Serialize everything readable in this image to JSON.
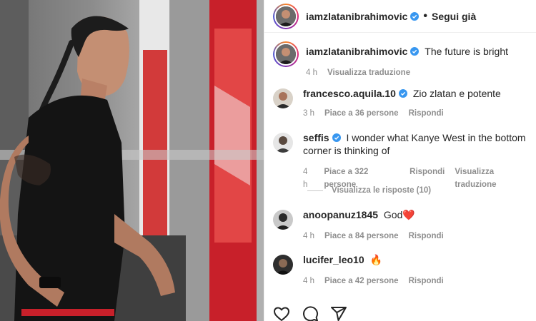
{
  "header": {
    "username": "iamzlatanibrahimovic",
    "separator": "•",
    "follow_label": "Segui già"
  },
  "caption": {
    "username": "iamzlatanibrahimovic",
    "text": "The future is bright",
    "time": "4 h",
    "translate": "Visualizza traduzione"
  },
  "comments": [
    {
      "username": "francesco.aquila.10",
      "verified": true,
      "text": "Zio zlatan e potente",
      "time": "3 h",
      "likes": "Piace a 36 persone",
      "reply": "Rispondi"
    },
    {
      "username": "seffis",
      "verified": true,
      "text": "I wonder what Kanye West in the bottom corner is thinking of",
      "time": "4 h",
      "likes": "Piace a 322 persone",
      "reply": "Rispondi",
      "translate": "Visualizza traduzione",
      "view_replies": "Visualizza le risposte (10)"
    },
    {
      "username": "anoopanuz1845",
      "verified": false,
      "text": "God❤️",
      "time": "4 h",
      "likes": "Piace a 84 persone",
      "reply": "Rispondi"
    },
    {
      "username": "lucifer_leo10",
      "verified": false,
      "text": "🔥",
      "time": "4 h",
      "likes": "Piace a 42 persone",
      "reply": "Rispondi"
    }
  ],
  "actions": [
    "heart-icon",
    "comment-icon",
    "share-icon"
  ],
  "colors": {
    "text": "#262626",
    "secondary": "#8e8e8e",
    "verified": "#3897f0",
    "accent_red": "#c8202a"
  }
}
